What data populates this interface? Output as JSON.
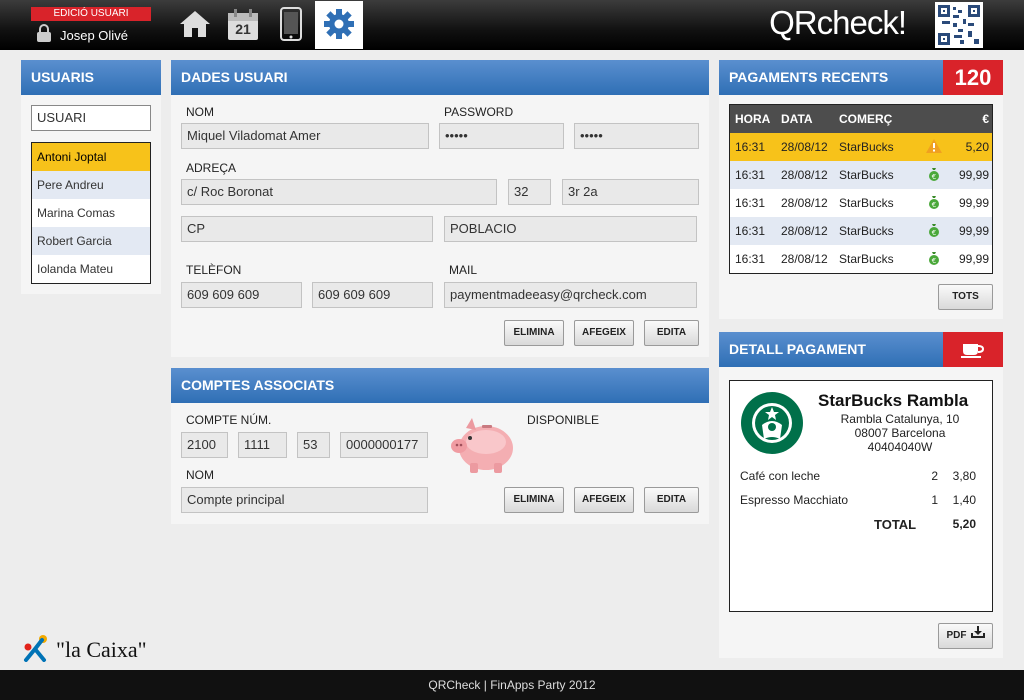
{
  "header": {
    "mode_badge": "EDICIÓ USUARI",
    "user_name": "Josep Olivé",
    "app_logo": "QRcheck!",
    "nav": [
      {
        "icon": "home-icon"
      },
      {
        "icon": "calendar-icon",
        "day": "21"
      },
      {
        "icon": "mobile-icon"
      },
      {
        "icon": "gear-icon",
        "active": true
      }
    ]
  },
  "users": {
    "title": "USUARIS",
    "search_value": "USUARI",
    "items": [
      {
        "name": "Antoni Joptal"
      },
      {
        "name": "Pere Andreu"
      },
      {
        "name": "Marina Comas"
      },
      {
        "name": "Robert Garcia"
      },
      {
        "name": "Iolanda Mateu"
      }
    ]
  },
  "user_data": {
    "title": "DADES USUARI",
    "labels": {
      "name": "NOM",
      "password": "PASSWORD",
      "address": "ADREÇA",
      "phone": "TELÈFON",
      "mail": "MAIL"
    },
    "name": "Miquel Viladomat Amer",
    "password": "•••••",
    "password_confirm": "•••••",
    "street": "c/ Roc Boronat",
    "number": "32",
    "floor": "3r 2a",
    "cp_placeholder": "CP",
    "city_placeholder": "POBLACIO",
    "phone1": "609 609 609",
    "phone2": "609 609 609",
    "mail": "paymentmadeeasy@qrcheck.com",
    "buttons": {
      "delete": "ELIMINA",
      "add": "AFEGEIX",
      "edit": "EDITA"
    }
  },
  "accounts": {
    "title": "COMPTES ASSOCIATS",
    "labels": {
      "account_no": "COMPTE NÚM.",
      "available": "DISPONIBLE",
      "name": "NOM"
    },
    "entity": "2100",
    "office": "1111",
    "dc": "53",
    "account": "0000000177",
    "name": "Compte principal",
    "buttons": {
      "delete": "ELIMINA",
      "add": "AFEGEIX",
      "edit": "EDITA"
    }
  },
  "payments": {
    "title": "PAGAMENTS RECENTS",
    "count": "120",
    "columns": [
      "HORA",
      "DATA",
      "COMERÇ",
      "",
      "€"
    ],
    "rows": [
      {
        "time": "16:31",
        "date": "28/08/12",
        "shop": "StarBucks",
        "icon": "warning-icon",
        "amount": "5,20"
      },
      {
        "time": "16:31",
        "date": "28/08/12",
        "shop": "StarBucks",
        "icon": "money-bag-icon",
        "amount": "99,99"
      },
      {
        "time": "16:31",
        "date": "28/08/12",
        "shop": "StarBucks",
        "icon": "money-bag-icon",
        "amount": "99,99"
      },
      {
        "time": "16:31",
        "date": "28/08/12",
        "shop": "StarBucks",
        "icon": "money-bag-icon",
        "amount": "99,99"
      },
      {
        "time": "16:31",
        "date": "28/08/12",
        "shop": "StarBucks",
        "icon": "money-bag-icon",
        "amount": "99,99"
      }
    ],
    "all_button": "TOTS"
  },
  "detail": {
    "title": "DETALL PAGAMENT",
    "shop_name": "StarBucks Rambla",
    "address1": "Rambla Catalunya, 10",
    "address2": "08007 Barcelona",
    "tax_id": "40404040W",
    "lines": [
      {
        "item": "Café con leche",
        "qty": "2",
        "price": "3,80"
      },
      {
        "item": "Espresso Macchiato",
        "qty": "1",
        "price": "1,40"
      }
    ],
    "total_label": "TOTAL",
    "total": "5,20",
    "pdf_button": "PDF"
  },
  "brand": {
    "logo_text": "\"la Caixa\""
  },
  "footer": {
    "text": "QRCheck | FinApps Party 2012"
  },
  "colors": {
    "accent_blue": "#2f6fb5",
    "highlight_yellow": "#f7c21a",
    "badge_red": "#d9232a"
  }
}
